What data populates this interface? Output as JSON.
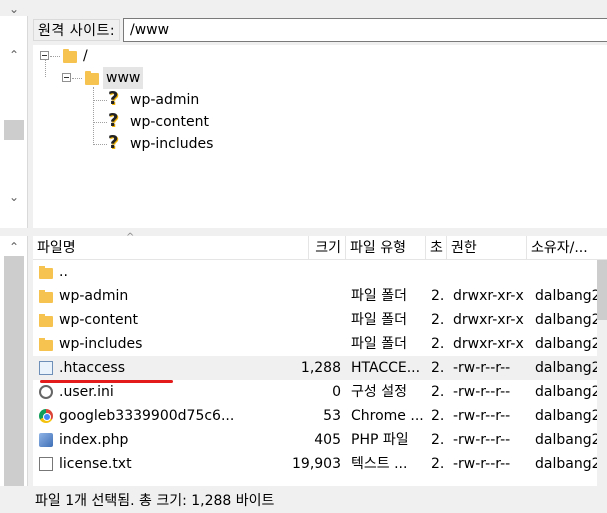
{
  "site_bar": {
    "label": "원격 사이트:",
    "path": "/www"
  },
  "tree": {
    "root": "/",
    "www": "www",
    "children": [
      "wp-admin",
      "wp-content",
      "wp-includes"
    ]
  },
  "columns": {
    "name": "파일명",
    "size": "크기",
    "type": "파일 유형",
    "modified": "초",
    "permissions": "권한",
    "owner": "소유자/..."
  },
  "files": [
    {
      "name": "..",
      "size": "",
      "type": "",
      "modified": "",
      "permissions": "",
      "owner": "",
      "icon": "folder-icon"
    },
    {
      "name": "wp-admin",
      "size": "",
      "type": "파일 폴더",
      "modified": "2.",
      "permissions": "drwxr-xr-x",
      "owner": "dalbang2",
      "icon": "folder-icon"
    },
    {
      "name": "wp-content",
      "size": "",
      "type": "파일 폴더",
      "modified": "2.",
      "permissions": "drwxr-xr-x",
      "owner": "dalbang2",
      "icon": "folder-icon"
    },
    {
      "name": "wp-includes",
      "size": "",
      "type": "파일 폴더",
      "modified": "2.",
      "permissions": "drwxr-xr-x",
      "owner": "dalbang2",
      "icon": "folder-icon"
    },
    {
      "name": ".htaccess",
      "size": "1,288",
      "type": "HTACCE...",
      "modified": "2.",
      "permissions": "-rw-r--r--",
      "owner": "dalbang2",
      "icon": "document-icon"
    },
    {
      "name": ".user.ini",
      "size": "0",
      "type": "구성 설정",
      "modified": "2.",
      "permissions": "-rw-r--r--",
      "owner": "dalbang2",
      "icon": "settings-file-icon"
    },
    {
      "name": "googleb3339900d75c6...",
      "size": "53",
      "type": "Chrome ...",
      "modified": "2.",
      "permissions": "-rw-r--r--",
      "owner": "dalbang2",
      "icon": "chrome-icon"
    },
    {
      "name": "index.php",
      "size": "405",
      "type": "PHP 파일",
      "modified": "2.",
      "permissions": "-rw-r--r--",
      "owner": "dalbang2",
      "icon": "php-file-icon"
    },
    {
      "name": "license.txt",
      "size": "19,903",
      "type": "텍스트 ...",
      "modified": "2.",
      "permissions": "-rw-r--r--",
      "owner": "dalbang2",
      "icon": "text-file-icon"
    }
  ],
  "selected_file": ".htaccess",
  "status": "파일 1개 선택됨. 총 크기: 1,288 바이트",
  "colors": {
    "annotation_underline": "#e31b1b",
    "folder": "#f6c350"
  }
}
